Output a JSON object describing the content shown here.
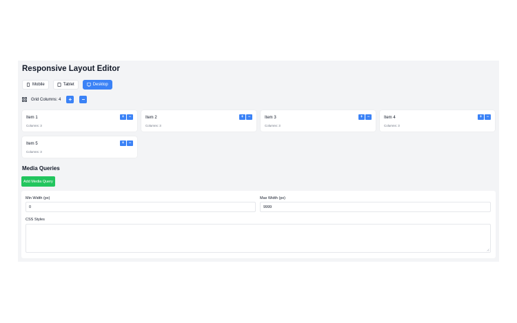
{
  "title": "Responsive Layout Editor",
  "devices": [
    {
      "label": "Mobile",
      "icon": "phone-icon",
      "active": false
    },
    {
      "label": "Tablet",
      "icon": "tablet-icon",
      "active": false
    },
    {
      "label": "Desktop",
      "icon": "monitor-icon",
      "active": true
    }
  ],
  "grid": {
    "label": "Grid Columns: 4",
    "icon": "grid-icon",
    "plus": "+",
    "minus": "−"
  },
  "items": [
    {
      "name": "Item 1",
      "columns": "Columns: 3"
    },
    {
      "name": "Item 2",
      "columns": "Columns: 3"
    },
    {
      "name": "Item 3",
      "columns": "Columns: 3"
    },
    {
      "name": "Item 4",
      "columns": "Columns: 3"
    },
    {
      "name": "Item 5",
      "columns": "Columns: 3"
    }
  ],
  "item_buttons": {
    "plus": "+",
    "minus": "−"
  },
  "media": {
    "title": "Media Queries",
    "add_label": "Add Media Query",
    "min_label": "Min Width (px)",
    "min_value": "0",
    "max_label": "Max Width (px)",
    "max_value": "9999",
    "css_label": "CSS Styles",
    "css_value": ""
  },
  "colors": {
    "accent": "#3b82f6",
    "success": "#22c55e",
    "panel": "#f3f4f6"
  }
}
